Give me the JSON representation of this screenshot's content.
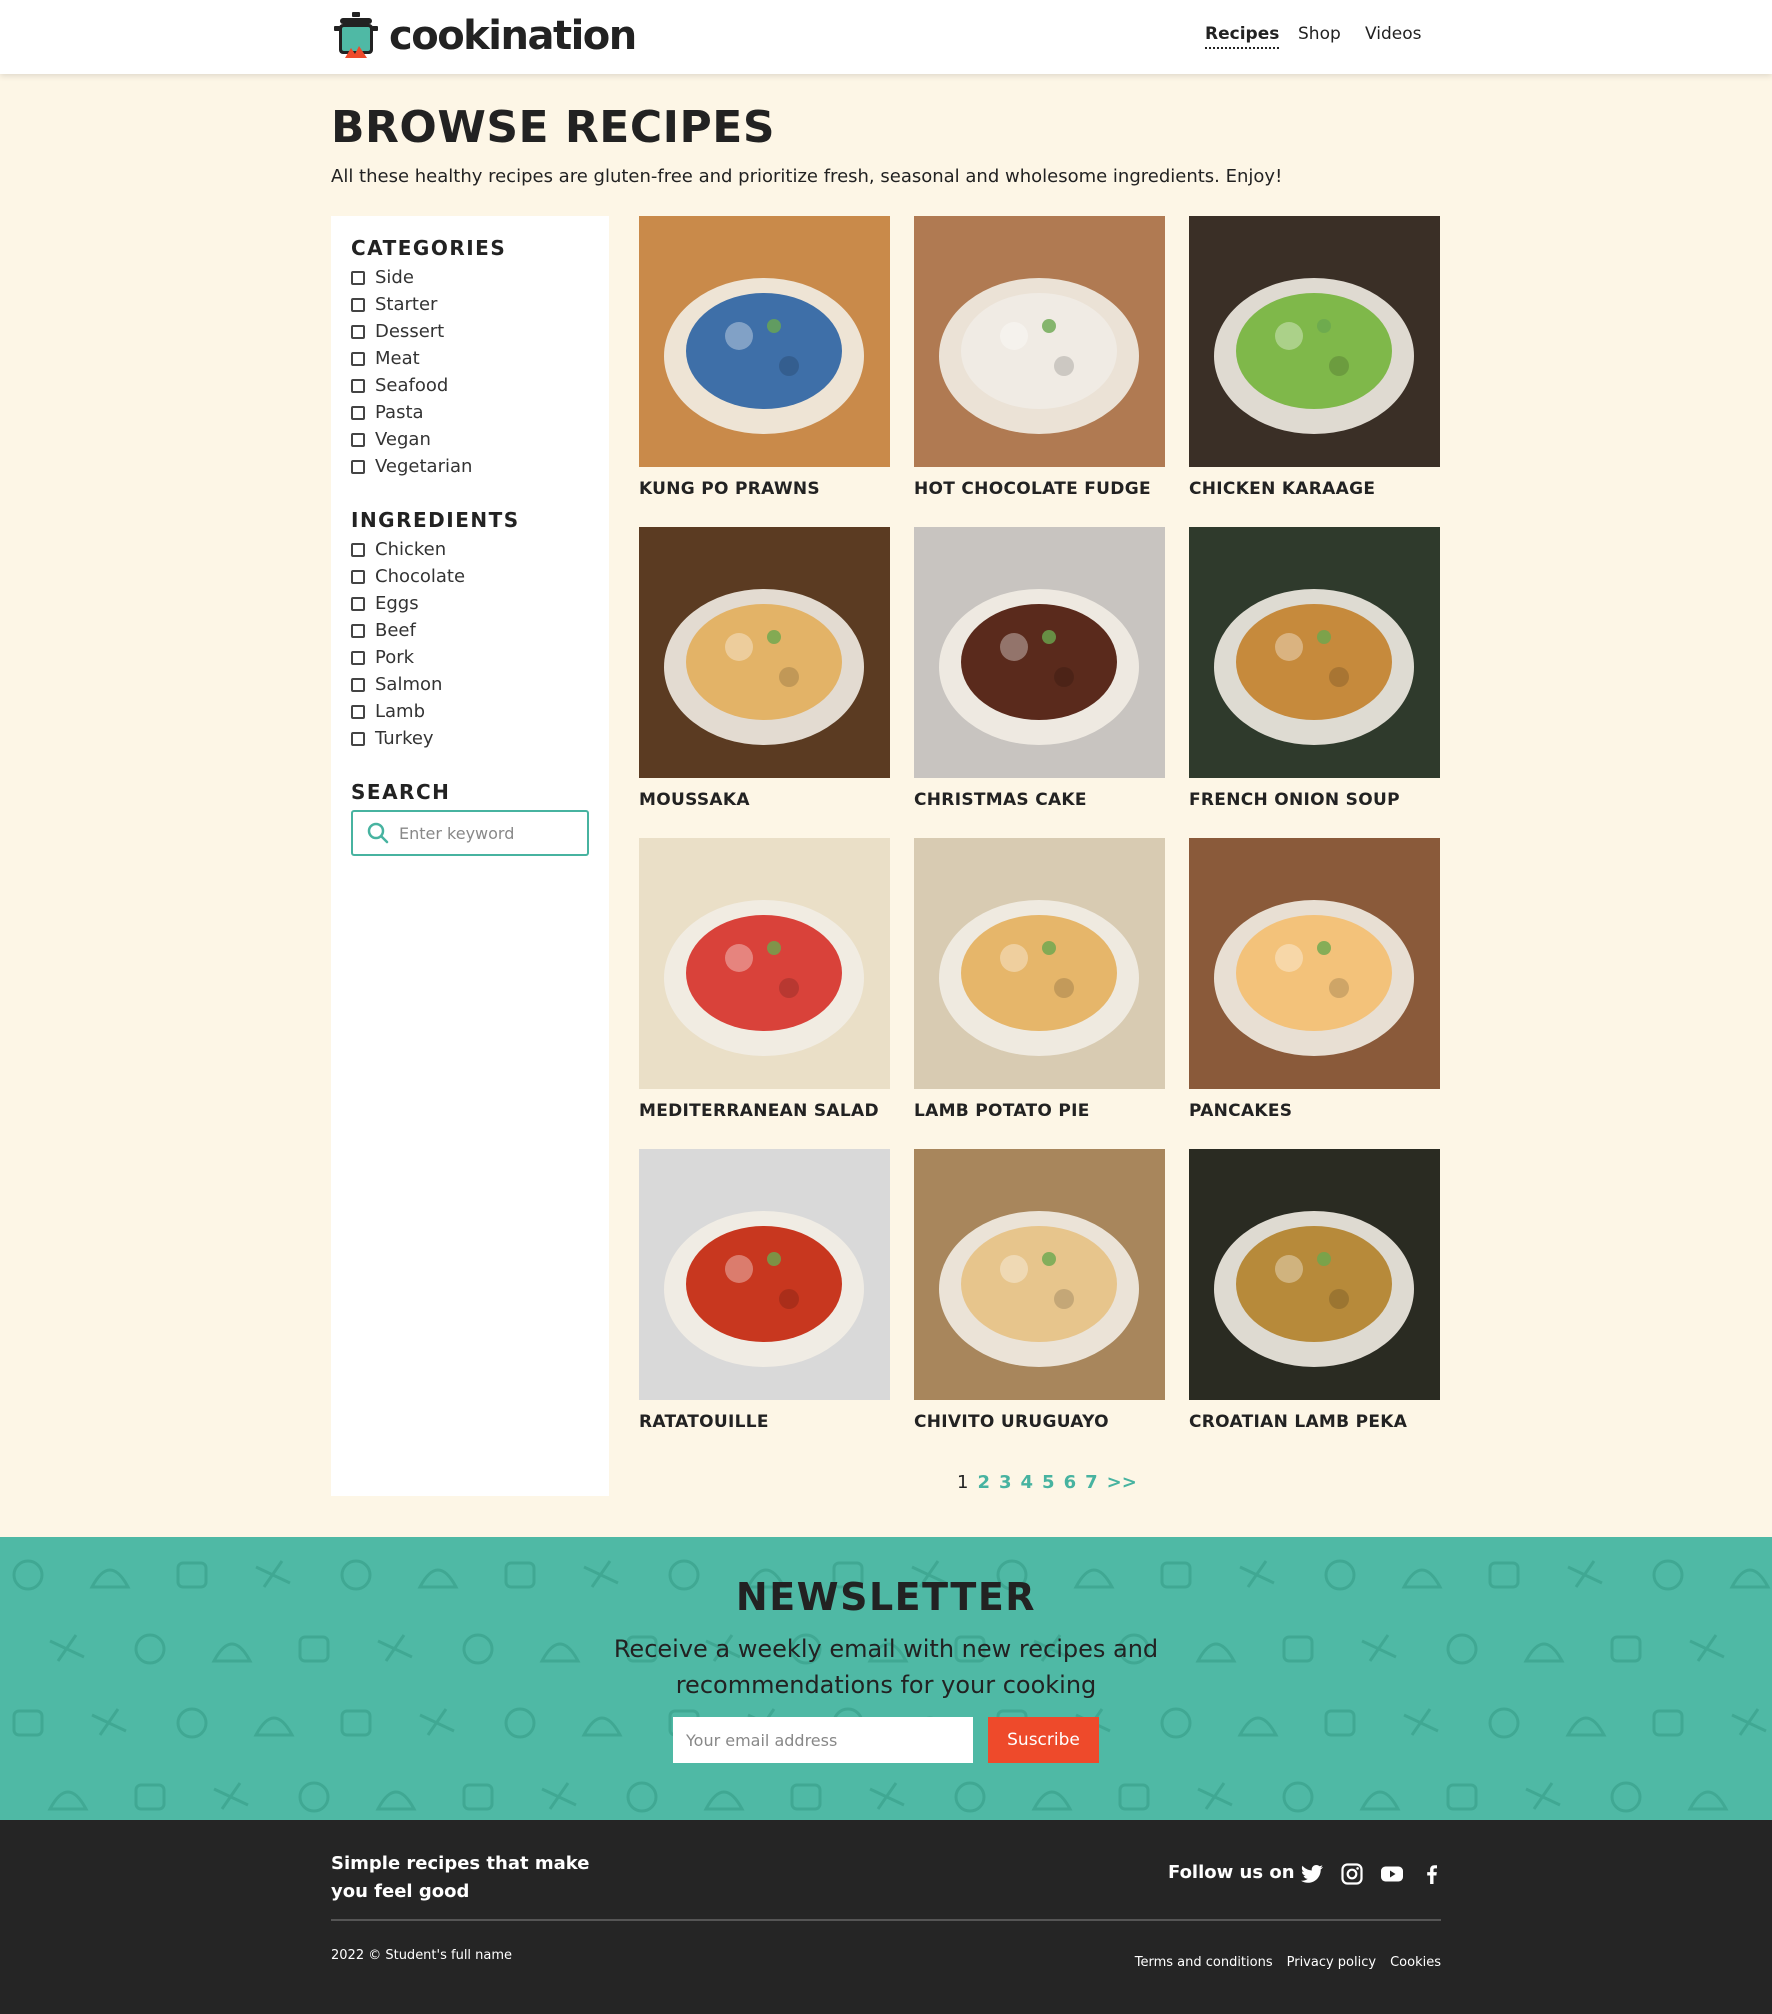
{
  "header": {
    "logo_text": "cookination",
    "nav": [
      {
        "label": "Recipes",
        "active": true
      },
      {
        "label": "Shop",
        "active": false
      },
      {
        "label": "Videos",
        "active": false
      }
    ]
  },
  "page": {
    "title": "BROWSE RECIPES",
    "intro": "All these healthy recipes are gluten-free and prioritize fresh, seasonal and wholesome ingredients. Enjoy!"
  },
  "sidebar": {
    "categories_heading": "CATEGORIES",
    "categories": [
      "Side",
      "Starter",
      "Dessert",
      "Meat",
      "Seafood",
      "Pasta",
      "Vegan",
      "Vegetarian"
    ],
    "ingredients_heading": "INGREDIENTS",
    "ingredients": [
      "Chicken",
      "Chocolate",
      "Eggs",
      "Beef",
      "Pork",
      "Salmon",
      "Lamb",
      "Turkey"
    ],
    "search_heading": "SEARCH",
    "search_placeholder": "Enter keyword"
  },
  "recipes": [
    {
      "title": "KUNG PO PRAWNS",
      "bg": "#c98a4a",
      "accent": "#3e6fa8",
      "icon": "bowl-icon"
    },
    {
      "title": "HOT CHOCOLATE FUDGE",
      "bg": "#b07a52",
      "accent": "#f0ebe4",
      "icon": "cake-slice-icon"
    },
    {
      "title": "CHICKEN KARAAGE",
      "bg": "#3a2f26",
      "accent": "#7fb84a",
      "icon": "sandwich-icon"
    },
    {
      "title": "MOUSSAKA",
      "bg": "#5b3b22",
      "accent": "#e3b367",
      "icon": "pan-icon"
    },
    {
      "title": "CHRISTMAS CAKE",
      "bg": "#c8c4c0",
      "accent": "#5a2a1c",
      "icon": "cake-icon"
    },
    {
      "title": "FRENCH ONION SOUP",
      "bg": "#2f3a2c",
      "accent": "#c68a3c",
      "icon": "pot-icon"
    },
    {
      "title": "MEDITERRANEAN SALAD",
      "bg": "#eadfc7",
      "accent": "#d9423a",
      "icon": "pasta-icon"
    },
    {
      "title": "LAMB POTATO PIE",
      "bg": "#d8cbb2",
      "accent": "#e6b66a",
      "icon": "pie-icon"
    },
    {
      "title": "PANCAKES",
      "bg": "#8a5a3a",
      "accent": "#f3c27a",
      "icon": "pancake-icon"
    },
    {
      "title": "RATATOUILLE",
      "bg": "#d9d9d9",
      "accent": "#c8371f",
      "icon": "pan-icon"
    },
    {
      "title": "CHIVITO URUGUAYO",
      "bg": "#a8865c",
      "accent": "#e7c58c",
      "icon": "sandwich-icon"
    },
    {
      "title": "CROATIAN LAMB PEKA",
      "bg": "#2a2b22",
      "accent": "#b78a3a",
      "icon": "pan-icon"
    }
  ],
  "pagination": {
    "pages": [
      "1",
      "2",
      "3",
      "4",
      "5",
      "6",
      "7"
    ],
    "current": "1",
    "next_label": ">>"
  },
  "newsletter": {
    "title": "NEWSLETTER",
    "text": "Receive a weekly email with new recipes and recommendations for your cooking",
    "email_placeholder": "Your email address",
    "button_label": "Suscribe",
    "bg_color": "#4fb9a5",
    "button_color": "#ee4a2b"
  },
  "footer": {
    "tagline": "Simple recipes that make you feel good",
    "follow_label": "Follow us on",
    "social": [
      "twitter-icon",
      "instagram-icon",
      "youtube-icon",
      "facebook-icon"
    ],
    "copyright": "2022 © Student's full name",
    "links": [
      "Terms and conditions",
      "Privacy policy",
      "Cookies"
    ]
  },
  "colors": {
    "accent": "#47b3a0",
    "page_bg": "#fdf6e6",
    "footer_bg": "#252525"
  }
}
